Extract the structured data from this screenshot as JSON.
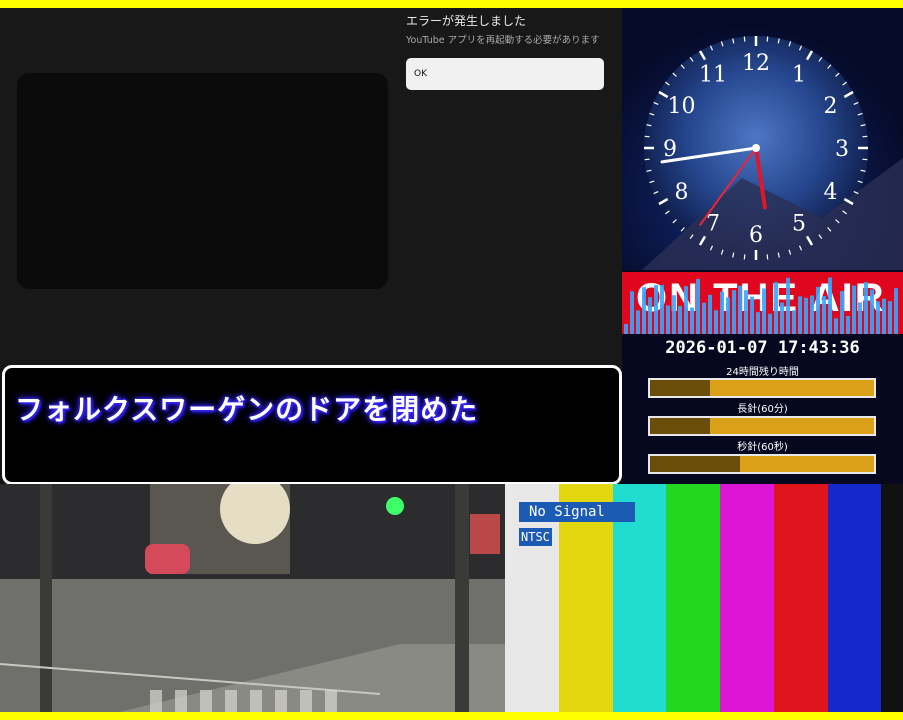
{
  "youtube": {
    "error_title": "エラーが発生しました",
    "error_message": "YouTube アプリを再起動する必要があります",
    "ok_label": "OK"
  },
  "caption": {
    "text": "フォルクスワーゲンのドアを閉めた"
  },
  "clock": {
    "numerals": [
      "12",
      "1",
      "2",
      "3",
      "4",
      "5",
      "6",
      "7",
      "8",
      "9",
      "10",
      "11"
    ],
    "onair_text": "ON THE AIR",
    "datetime": "2026-01-07 17:43:36",
    "bars": [
      {
        "label": "24時間残り時間",
        "fill": 0.27
      },
      {
        "label": "長針(60分)",
        "fill": 0.27
      },
      {
        "label": "秒針(60秒)",
        "fill": 0.4
      }
    ]
  },
  "test_pattern": {
    "no_signal": "No Signal",
    "ntsc": "NTSC",
    "colors": [
      "#e8e8e8",
      "#e3d80f",
      "#1fdccf",
      "#23d61f",
      "#dd15d4",
      "#e0141c",
      "#1428cc",
      "#111111"
    ]
  },
  "colors": {
    "border": "#ffff00",
    "caption_glow": "#3b2cff",
    "onair_red": "#e0061d"
  }
}
